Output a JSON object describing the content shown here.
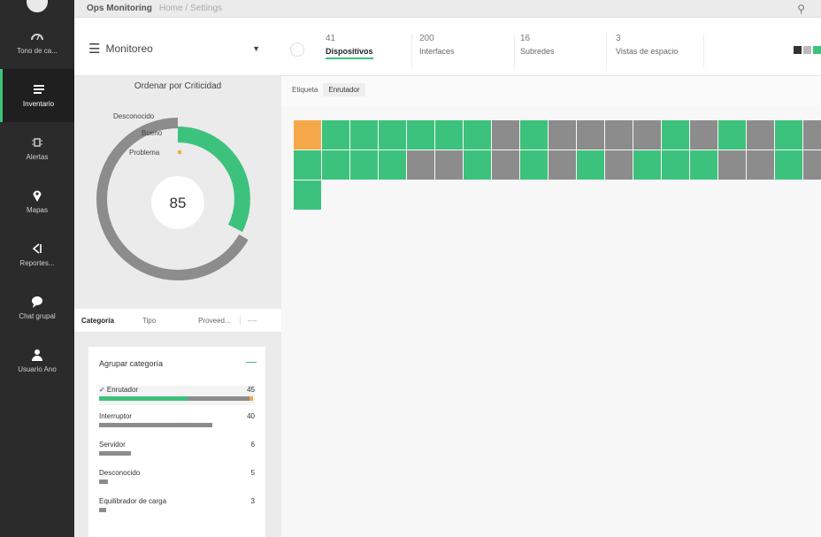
{
  "topbar": {
    "crumb": "Ops Monitoring",
    "crumb2": "Home / Settings"
  },
  "sidebar": {
    "items": [
      {
        "label": "Tono de ca...",
        "icon": "dashboard-icon"
      },
      {
        "label": "Inventario",
        "icon": "inventory-icon",
        "active": true
      },
      {
        "label": "Alertas",
        "icon": "alert-icon"
      },
      {
        "label": "Mapas",
        "icon": "map-pin-icon"
      },
      {
        "label": "Reportes...",
        "icon": "share-icon"
      },
      {
        "label": "Chat grupal",
        "icon": "chat-icon"
      },
      {
        "label": "Usuario Ano",
        "icon": "user-icon"
      }
    ]
  },
  "header": {
    "monitor_label": "Monitoreo",
    "stats": [
      {
        "num": "41",
        "label": "Dispositivos",
        "active": true
      },
      {
        "num": "200",
        "label": "Interfaces"
      },
      {
        "num": "16",
        "label": "Subredes"
      },
      {
        "num": "3",
        "label": "Vistas de espacio"
      }
    ]
  },
  "donut": {
    "title": "Ordenar por Criticidad",
    "center_value": "85",
    "legend": [
      "Desconocido",
      "Bueno",
      "Problema"
    ],
    "segments": [
      {
        "name": "Desconocido",
        "fraction": 0.66,
        "color": "#8c8c8c"
      },
      {
        "name": "Bueno",
        "fraction": 0.28,
        "color": "#3cc27c"
      },
      {
        "name": "Problema",
        "fraction": 0.02,
        "color": "#f0a64a"
      }
    ]
  },
  "tabs": [
    "Categoría",
    "Tipo",
    "Proveed...",
    "----"
  ],
  "categories": {
    "header": "Agrupar categoría",
    "rows": [
      {
        "label": "✓ Enrutador",
        "count": "45",
        "green_fraction": 0.6,
        "gray_fraction": 0.38,
        "selected": true
      },
      {
        "label": "Interruptor",
        "count": "40",
        "green_fraction": 0,
        "gray_fraction": 0.77
      },
      {
        "label": "Servidor",
        "count": "6",
        "green_fraction": 0,
        "gray_fraction": 0.2
      },
      {
        "label": "Desconocido",
        "count": "5",
        "green_fraction": 0,
        "gray_fraction": 0.06
      },
      {
        "label": "Equilibrador de carga",
        "count": "3",
        "green_fraction": 0,
        "gray_fraction": 0.04
      }
    ]
  },
  "filter": {
    "label": "Etiqueta",
    "chip": "Enrutador"
  },
  "tiles": {
    "row1": [
      "orange",
      "green",
      "green",
      "green",
      "green",
      "green",
      "green",
      "gray",
      "green",
      "gray",
      "gray",
      "gray",
      "gray",
      "green",
      "gray",
      "green",
      "gray",
      "green",
      "gray"
    ],
    "row2": [
      "green",
      "green",
      "green",
      "green",
      "gray",
      "gray",
      "green",
      "gray",
      "green",
      "gray",
      "green",
      "gray",
      "green",
      "green",
      "green",
      "gray",
      "gray",
      "green",
      "gray"
    ],
    "row3": [
      "green"
    ]
  },
  "colors": {
    "green": "#3cc27c",
    "gray": "#8c8c8c",
    "orange": "#f5a84a",
    "sidebar": "#2b2b2b"
  }
}
